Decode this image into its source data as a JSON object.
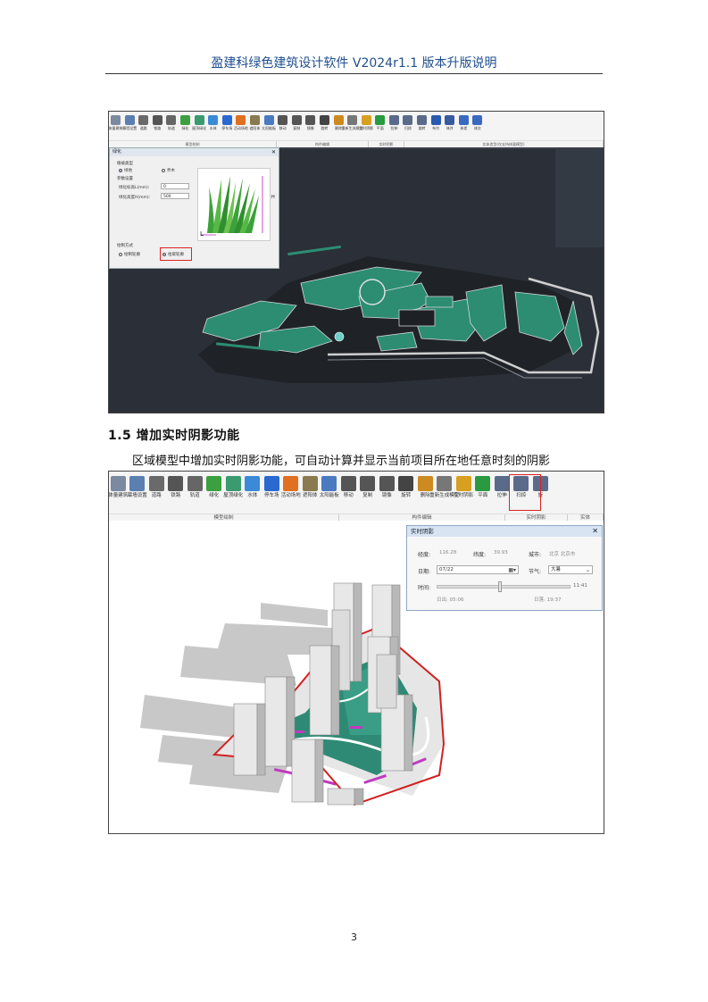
{
  "header": {
    "title": "盈建科绿色建筑设计软件 V2024r1.1 版本升版说明"
  },
  "figure1": {
    "toolbar": {
      "buttons": [
        {
          "label": "体量建筑",
          "color": "#7a8aa0"
        },
        {
          "label": "幕墙设置",
          "color": "#5a7fb0"
        },
        {
          "label": "道路",
          "color": "#6a6a6a"
        },
        {
          "label": "铁路",
          "color": "#555555"
        },
        {
          "label": "轨道",
          "color": "#666666"
        },
        {
          "label": "绿化",
          "color": "#3aa040"
        },
        {
          "label": "屋顶绿化",
          "color": "#3a9a70"
        },
        {
          "label": "水体",
          "color": "#3a8ad8"
        },
        {
          "label": "停车场",
          "color": "#2a6ad0"
        },
        {
          "label": "活动场地",
          "color": "#e07020"
        },
        {
          "label": "遮阳体",
          "color": "#8a7a50"
        },
        {
          "label": "太阳能板",
          "color": "#4a7ac0"
        },
        {
          "label": "移动",
          "color": "#555555"
        },
        {
          "label": "复制",
          "color": "#555555"
        },
        {
          "label": "镜像",
          "color": "#555555"
        },
        {
          "label": "旋转",
          "color": "#444444"
        },
        {
          "label": "删除",
          "color": "#cc8a20"
        },
        {
          "label": "重新生成模型",
          "color": "#777777"
        },
        {
          "label": "实时阴影",
          "color": "#d8a020"
        },
        {
          "label": "平面",
          "color": "#2a9a40"
        },
        {
          "label": "拉伸",
          "color": "#5a6a8a"
        },
        {
          "label": "扫掠",
          "color": "#5a6a8a"
        },
        {
          "label": "旋转",
          "color": "#5a6a8a"
        },
        {
          "label": "布尔",
          "color": "#2a5ab0"
        },
        {
          "label": "体并",
          "color": "#3a5aa0"
        },
        {
          "label": "体差",
          "color": "#3a6ac0"
        },
        {
          "label": "体交",
          "color": "#3a6ac0"
        }
      ],
      "groups": [
        "模型绘制",
        "构件编辑",
        "实时阴影",
        "实体造型(仅支持体量模型)"
      ]
    },
    "dialog": {
      "title": "绿化",
      "close": "✕",
      "type_label": "植被类型",
      "opt_grass": "绿地",
      "opt_tree": "乔木",
      "params_label": "参数设置",
      "width_label": "绿化标高L(mm):",
      "width_value": "0",
      "height_label": "绿化高度H(mm):",
      "height_value": "500",
      "draw_label": "绘制方式",
      "opt_draw_contour": "绘制轮廓",
      "opt_pick_contour": "拾取轮廓",
      "preview_l": "L",
      "preview_h": "H"
    }
  },
  "section": {
    "heading": "1.5  增加实时阴影功能",
    "paragraph": "区域模型中增加实时阴影功能，可自动计算并显示当前项目所在地任意时刻的阴影"
  },
  "figure2": {
    "toolbar": {
      "buttons": [
        {
          "label": "体量建筑",
          "color": "#7a8aa0"
        },
        {
          "label": "幕墙设置",
          "color": "#5a7fb0"
        },
        {
          "label": "道路",
          "color": "#6a6a6a"
        },
        {
          "label": "铁路",
          "color": "#555555"
        },
        {
          "label": "轨道",
          "color": "#666666"
        },
        {
          "label": "绿化",
          "color": "#3aa040"
        },
        {
          "label": "屋顶绿化",
          "color": "#3a9a70"
        },
        {
          "label": "水体",
          "color": "#3a8ad8"
        },
        {
          "label": "停车场",
          "color": "#2a6ad0"
        },
        {
          "label": "活动场地",
          "color": "#e07020"
        },
        {
          "label": "遮阳体",
          "color": "#8a7a50"
        },
        {
          "label": "太阳能板",
          "color": "#4a7ac0"
        },
        {
          "label": "移动",
          "color": "#555555"
        },
        {
          "label": "复制",
          "color": "#555555"
        },
        {
          "label": "镜像",
          "color": "#555555"
        },
        {
          "label": "旋转",
          "color": "#444444"
        },
        {
          "label": "删除",
          "color": "#cc8a20"
        },
        {
          "label": "重新生成模型",
          "color": "#777777"
        },
        {
          "label": "实时阴影",
          "color": "#d8a020"
        },
        {
          "label": "平面",
          "color": "#2a9a40"
        },
        {
          "label": "拉伸",
          "color": "#5a6a8a"
        },
        {
          "label": "扫掠",
          "color": "#5a6a8a"
        },
        {
          "label": "旋",
          "color": "#5a6a8a"
        }
      ],
      "groups": [
        "模型绘制",
        "构件编辑",
        "实时阴影",
        "实体"
      ]
    },
    "shadow_panel": {
      "title": "实时阴影",
      "close": "✕",
      "longitude_label": "经度:",
      "longitude_value": "116.28",
      "latitude_label": "纬度:",
      "latitude_value": "39.93",
      "city_label": "城市:",
      "city_value": "北京 北京市",
      "date_label": "日期:",
      "date_value": "07/22",
      "solar_term_label": "节气:",
      "solar_term_value": "大暑",
      "time_label": "时间:",
      "time_value": "11:41",
      "time_fraction": 0.47,
      "sunrise": "日出: 05:06",
      "sunset": "日落: 19:37"
    }
  },
  "footer": {
    "page_number": "3"
  }
}
